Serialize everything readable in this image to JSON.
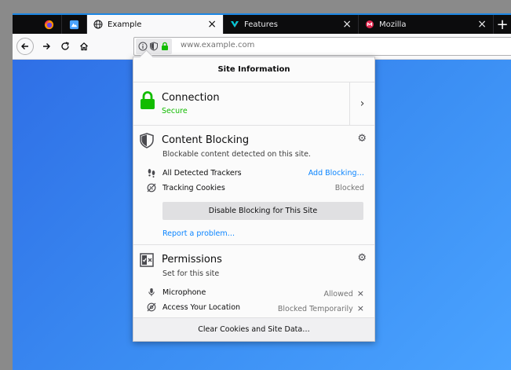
{
  "tabs": [
    {
      "title": "Example",
      "active": true
    },
    {
      "title": "Features",
      "active": false
    },
    {
      "title": "Mozilla",
      "active": false
    }
  ],
  "url": "www.example.com",
  "popup": {
    "title": "Site Information",
    "connection": {
      "title": "Connection",
      "status": "Secure"
    },
    "content_blocking": {
      "title": "Content Blocking",
      "subtitle": "Blockable content detected on this site.",
      "items": [
        {
          "label": "All Detected Trackers",
          "state": "Add Blocking…"
        },
        {
          "label": "Tracking Cookies",
          "state": "Blocked"
        }
      ],
      "disable_label": "Disable Blocking for This Site",
      "report_label": "Report a problem…"
    },
    "permissions": {
      "title": "Permissions",
      "subtitle": "Set for this site",
      "items": [
        {
          "label": "Microphone",
          "state": "Allowed"
        },
        {
          "label": "Access Your Location",
          "state": "Blocked Temporarily"
        }
      ]
    },
    "clear_label": "Clear Cookies and Site Data…"
  },
  "colors": {
    "secure": "#12bc00",
    "link": "#0a84ff",
    "tab_accent": "#1c86e3"
  },
  "icons": {
    "close_tab": "×",
    "new_tab": "+",
    "connection_more": "›",
    "gear": "⚙",
    "remove_permission": "×"
  }
}
